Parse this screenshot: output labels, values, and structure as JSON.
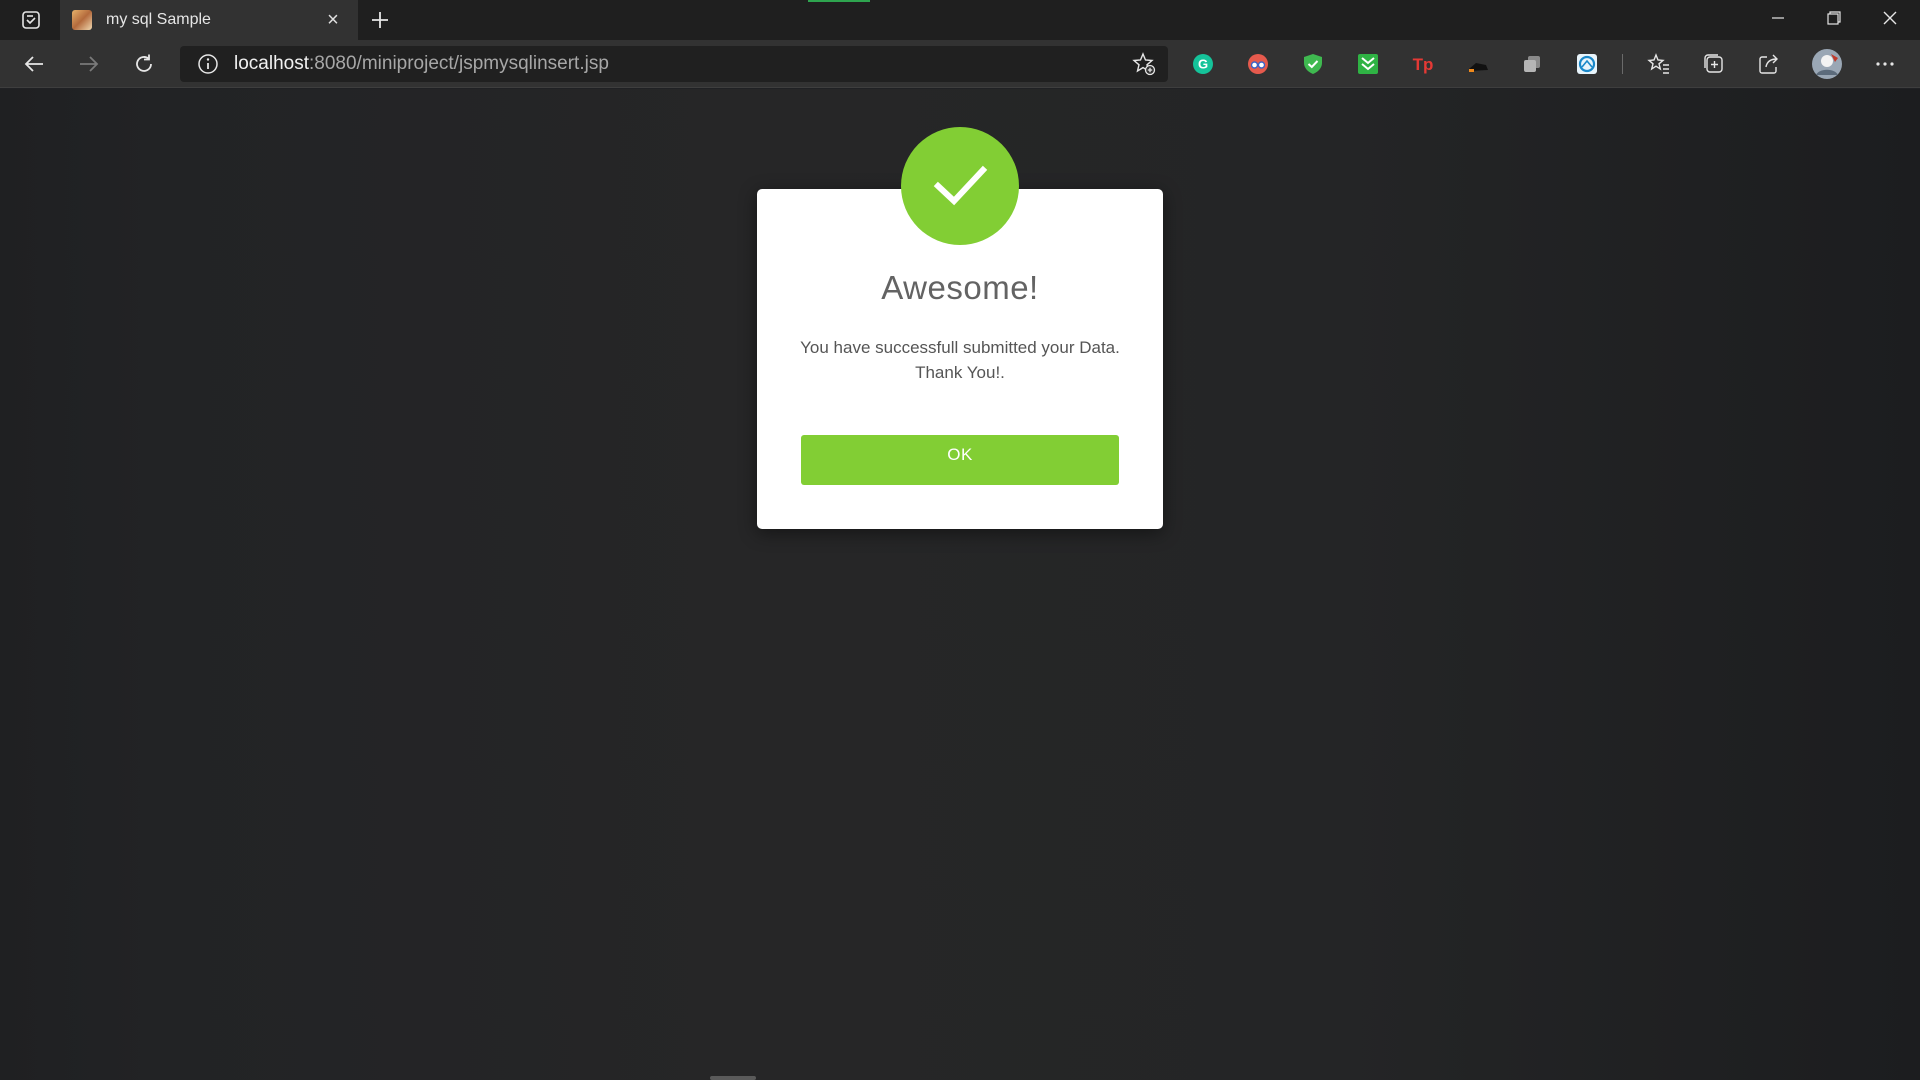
{
  "browser": {
    "tab": {
      "title": "my sql Sample",
      "close": "×"
    },
    "address": {
      "host": "localhost",
      "path": ":8080/miniproject/jspmysqlinsert.jsp"
    },
    "extensions": [
      "grammarly-icon",
      "reader-glasses-icon",
      "shield-check-icon",
      "green-download-icon",
      "tp-icon",
      "dark-extension-icon",
      "copy-extension-icon",
      "blue-ring-extension-icon"
    ]
  },
  "dialog": {
    "title": "Awesome!",
    "message": "You have successfull submitted your Data. Thank You!.",
    "ok_label": "OK",
    "accent_color": "#82ce34"
  }
}
